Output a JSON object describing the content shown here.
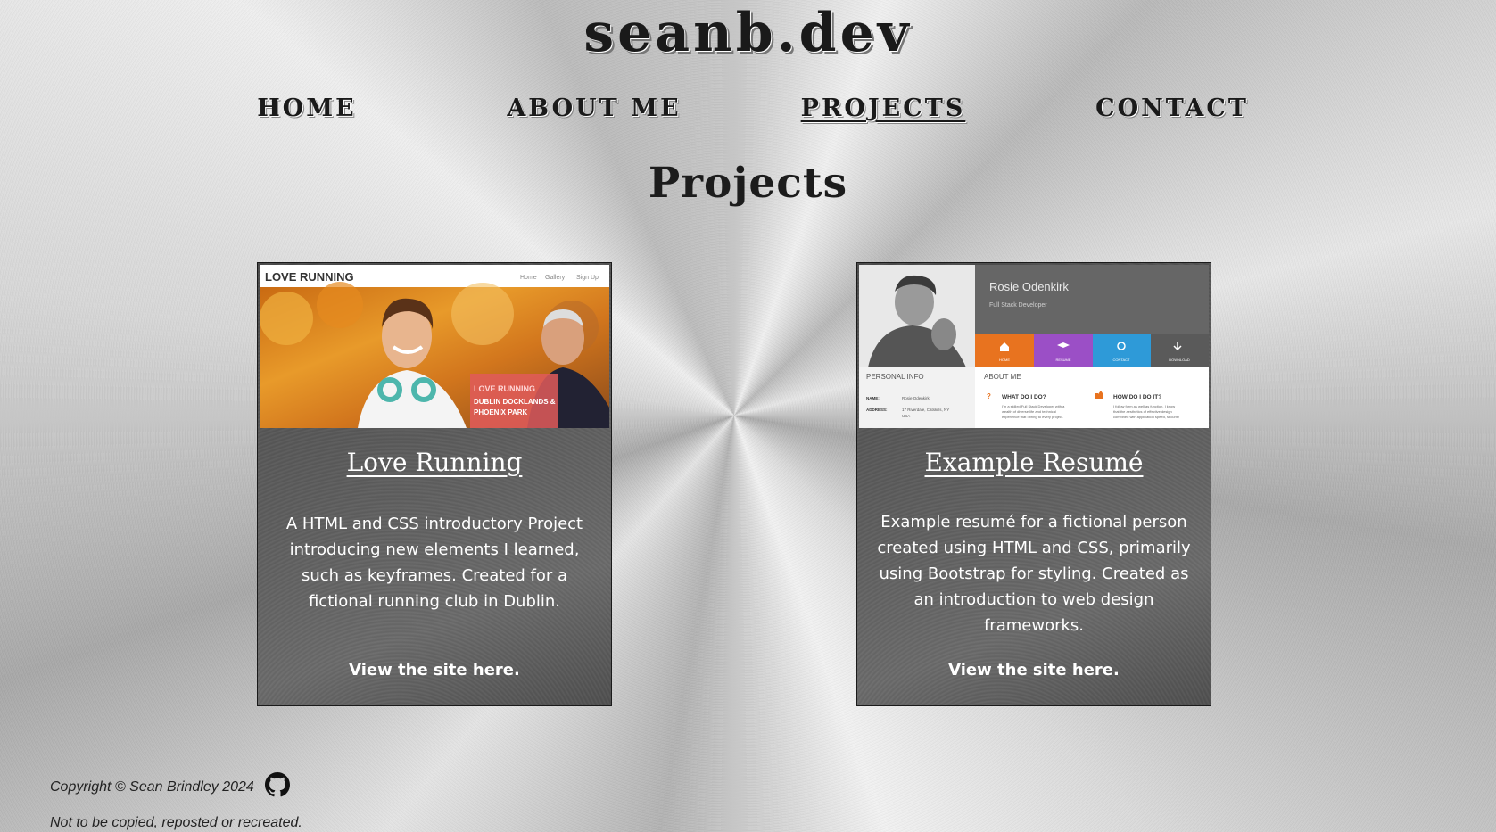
{
  "site": {
    "title": "seanb.dev"
  },
  "nav": {
    "items": [
      {
        "label": "HOME",
        "active": false
      },
      {
        "label": "ABOUT ME",
        "active": false
      },
      {
        "label": "PROJECTS",
        "active": true
      },
      {
        "label": "CONTACT",
        "active": false
      }
    ]
  },
  "page": {
    "title": "Projects"
  },
  "projects": [
    {
      "title": "Love Running",
      "description": "A HTML and CSS introductory Project introducing new elements I learned, such as keyframes. Created for a fictional running club in Dublin.",
      "link_label": "View the site here.",
      "screenshot": {
        "brand": "LOVE RUNNING",
        "menu": [
          "Home",
          "Gallery",
          "Sign Up"
        ],
        "banner": [
          "LOVE RUNNING",
          "DUBLIN DOCKLANDS &",
          "PHOENIX PARK"
        ]
      }
    },
    {
      "title": "Example Resumé",
      "description": "Example resumé for a fictional person created using HTML and CSS, primarily using Bootstrap for styling. Created as an introduction to web design frameworks.",
      "link_label": "View the site here.",
      "screenshot": {
        "name": "Rosie Odenkirk",
        "role": "Full Stack Developer",
        "tabs": [
          "HOME",
          "RESUME",
          "CONTACT",
          "DOWNLOAD"
        ],
        "tab_colors": [
          "#e8731f",
          "#9b4fc6",
          "#2e9ad8",
          "#5a5a5a"
        ],
        "left_heading": "PERSONAL INFO",
        "name_label": "NAME:",
        "name_value": "Rosie Odenkirk",
        "address_label": "ADDRESS:",
        "address_value": "17 Riverdale, Catskills, NY",
        "address_value2": "USA",
        "right_heading": "ABOUT ME",
        "q1": "WHAT DO I DO?",
        "q1_text": [
          "I'm a skilled Full Stack Developer with a",
          "wealth of diverse life and technical",
          "experience that I bring to every project."
        ],
        "q2": "HOW DO I DO IT?",
        "q2_text": [
          "I follow form as well as function. I know",
          "that the aesthetics of effective design",
          "combined with application speed, security"
        ]
      }
    }
  ],
  "footer": {
    "copyright": "Copyright © Sean Brindley 2024",
    "note": "Not to be copied, reposted or recreated.",
    "github_icon": "github-icon"
  }
}
